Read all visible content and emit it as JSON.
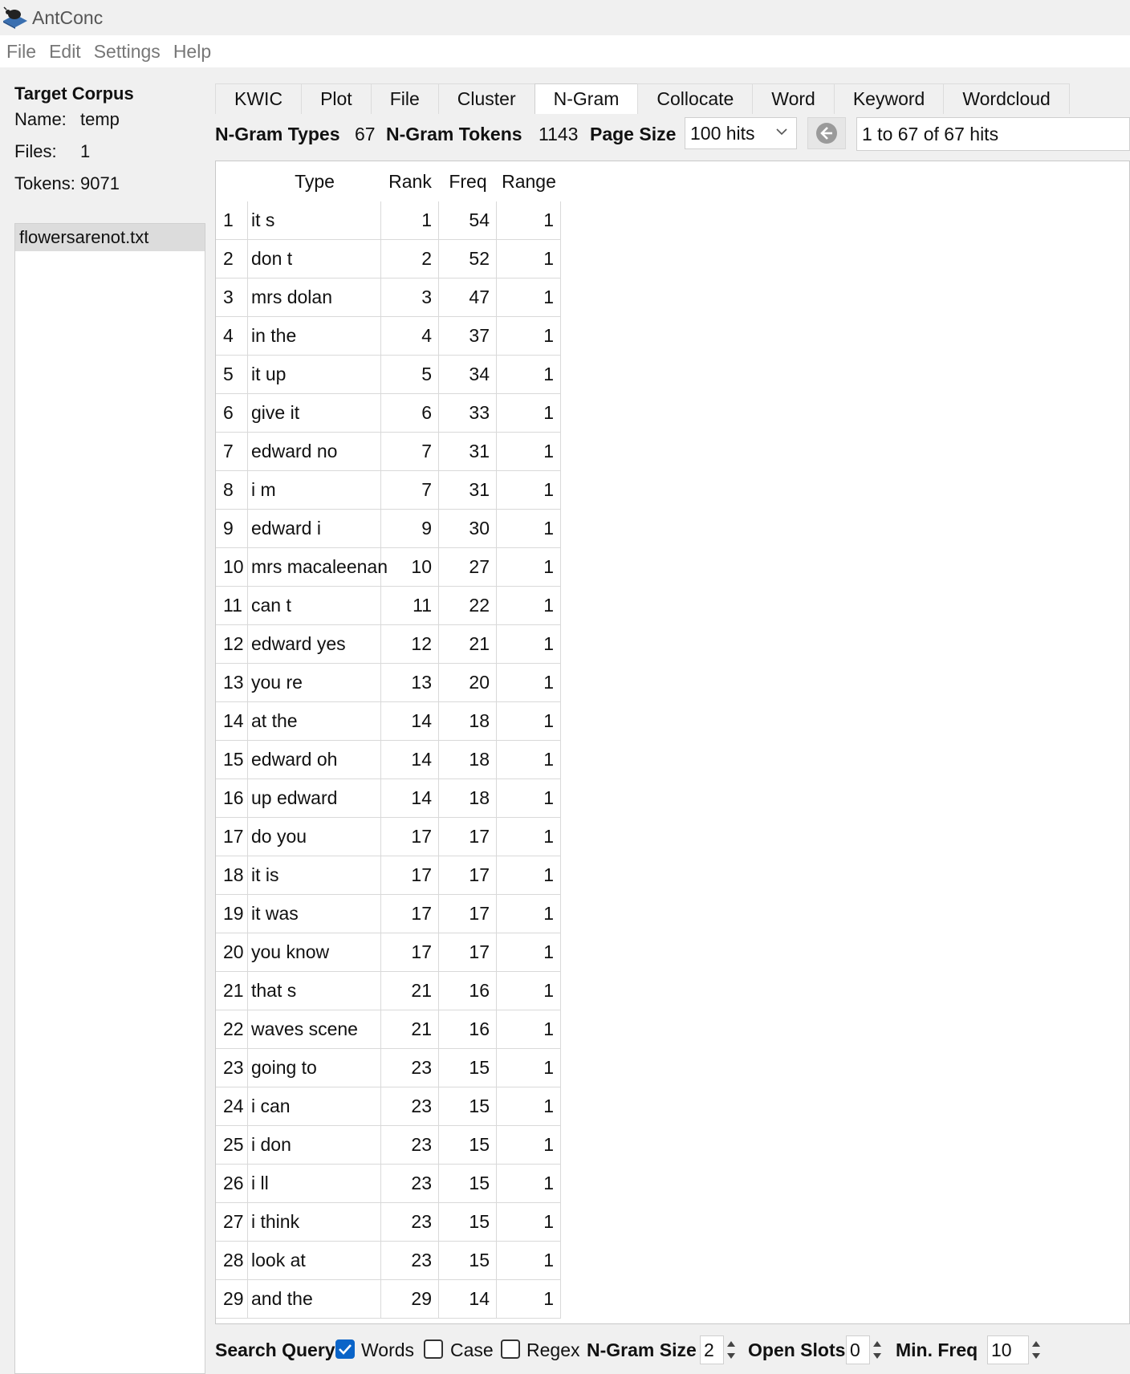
{
  "app": {
    "title": "AntConc"
  },
  "menu": [
    "File",
    "Edit",
    "Settings",
    "Help"
  ],
  "corpus": {
    "heading": "Target Corpus",
    "name_label": "Name:",
    "name_value": "temp",
    "files_label": "Files:",
    "files_value": "1",
    "tokens_label": "Tokens:",
    "tokens_value": "9071",
    "files": [
      "flowersarenot.txt"
    ]
  },
  "tabs": [
    "KWIC",
    "Plot",
    "File",
    "Cluster",
    "N-Gram",
    "Collocate",
    "Word",
    "Keyword",
    "Wordcloud"
  ],
  "active_tab": "N-Gram",
  "stats": {
    "types_label": "N-Gram Types",
    "types_value": "67",
    "tokens_label": "N-Gram Tokens",
    "tokens_value": "1143",
    "page_size_label": "Page Size",
    "page_size_value": "100 hits",
    "hits_text": "1 to 67 of 67 hits"
  },
  "table": {
    "columns": [
      "Type",
      "Rank",
      "Freq",
      "Range"
    ],
    "rows": [
      {
        "n": "1",
        "type": "it s",
        "rank": "1",
        "freq": "54",
        "range": "1"
      },
      {
        "n": "2",
        "type": "don t",
        "rank": "2",
        "freq": "52",
        "range": "1"
      },
      {
        "n": "3",
        "type": "mrs dolan",
        "rank": "3",
        "freq": "47",
        "range": "1"
      },
      {
        "n": "4",
        "type": "in the",
        "rank": "4",
        "freq": "37",
        "range": "1"
      },
      {
        "n": "5",
        "type": "it up",
        "rank": "5",
        "freq": "34",
        "range": "1"
      },
      {
        "n": "6",
        "type": "give it",
        "rank": "6",
        "freq": "33",
        "range": "1"
      },
      {
        "n": "7",
        "type": "edward no",
        "rank": "7",
        "freq": "31",
        "range": "1"
      },
      {
        "n": "8",
        "type": "i m",
        "rank": "7",
        "freq": "31",
        "range": "1"
      },
      {
        "n": "9",
        "type": "edward i",
        "rank": "9",
        "freq": "30",
        "range": "1"
      },
      {
        "n": "10",
        "type": "mrs macaleenan",
        "rank": "10",
        "freq": "27",
        "range": "1"
      },
      {
        "n": "11",
        "type": "can t",
        "rank": "11",
        "freq": "22",
        "range": "1"
      },
      {
        "n": "12",
        "type": "edward yes",
        "rank": "12",
        "freq": "21",
        "range": "1"
      },
      {
        "n": "13",
        "type": "you re",
        "rank": "13",
        "freq": "20",
        "range": "1"
      },
      {
        "n": "14",
        "type": "at the",
        "rank": "14",
        "freq": "18",
        "range": "1"
      },
      {
        "n": "15",
        "type": "edward oh",
        "rank": "14",
        "freq": "18",
        "range": "1"
      },
      {
        "n": "16",
        "type": "up edward",
        "rank": "14",
        "freq": "18",
        "range": "1"
      },
      {
        "n": "17",
        "type": "do you",
        "rank": "17",
        "freq": "17",
        "range": "1"
      },
      {
        "n": "18",
        "type": "it is",
        "rank": "17",
        "freq": "17",
        "range": "1"
      },
      {
        "n": "19",
        "type": "it was",
        "rank": "17",
        "freq": "17",
        "range": "1"
      },
      {
        "n": "20",
        "type": "you know",
        "rank": "17",
        "freq": "17",
        "range": "1"
      },
      {
        "n": "21",
        "type": "that s",
        "rank": "21",
        "freq": "16",
        "range": "1"
      },
      {
        "n": "22",
        "type": "waves scene",
        "rank": "21",
        "freq": "16",
        "range": "1"
      },
      {
        "n": "23",
        "type": "going to",
        "rank": "23",
        "freq": "15",
        "range": "1"
      },
      {
        "n": "24",
        "type": "i can",
        "rank": "23",
        "freq": "15",
        "range": "1"
      },
      {
        "n": "25",
        "type": "i don",
        "rank": "23",
        "freq": "15",
        "range": "1"
      },
      {
        "n": "26",
        "type": "i ll",
        "rank": "23",
        "freq": "15",
        "range": "1"
      },
      {
        "n": "27",
        "type": "i think",
        "rank": "23",
        "freq": "15",
        "range": "1"
      },
      {
        "n": "28",
        "type": "look at",
        "rank": "23",
        "freq": "15",
        "range": "1"
      },
      {
        "n": "29",
        "type": "and the",
        "rank": "29",
        "freq": "14",
        "range": "1"
      }
    ]
  },
  "search": {
    "query_label": "Search Query",
    "words_label": "Words",
    "words_checked": true,
    "case_label": "Case",
    "case_checked": false,
    "regex_label": "Regex",
    "regex_checked": false,
    "ngram_size_label": "N-Gram Size",
    "ngram_size_value": "2",
    "open_slots_label": "Open Slots",
    "open_slots_value": "0",
    "min_freq_label": "Min. Freq",
    "min_freq_value": "10"
  },
  "colors": {
    "accent": "#0a64c8",
    "selected_file_bg": "#dcdcdc"
  }
}
